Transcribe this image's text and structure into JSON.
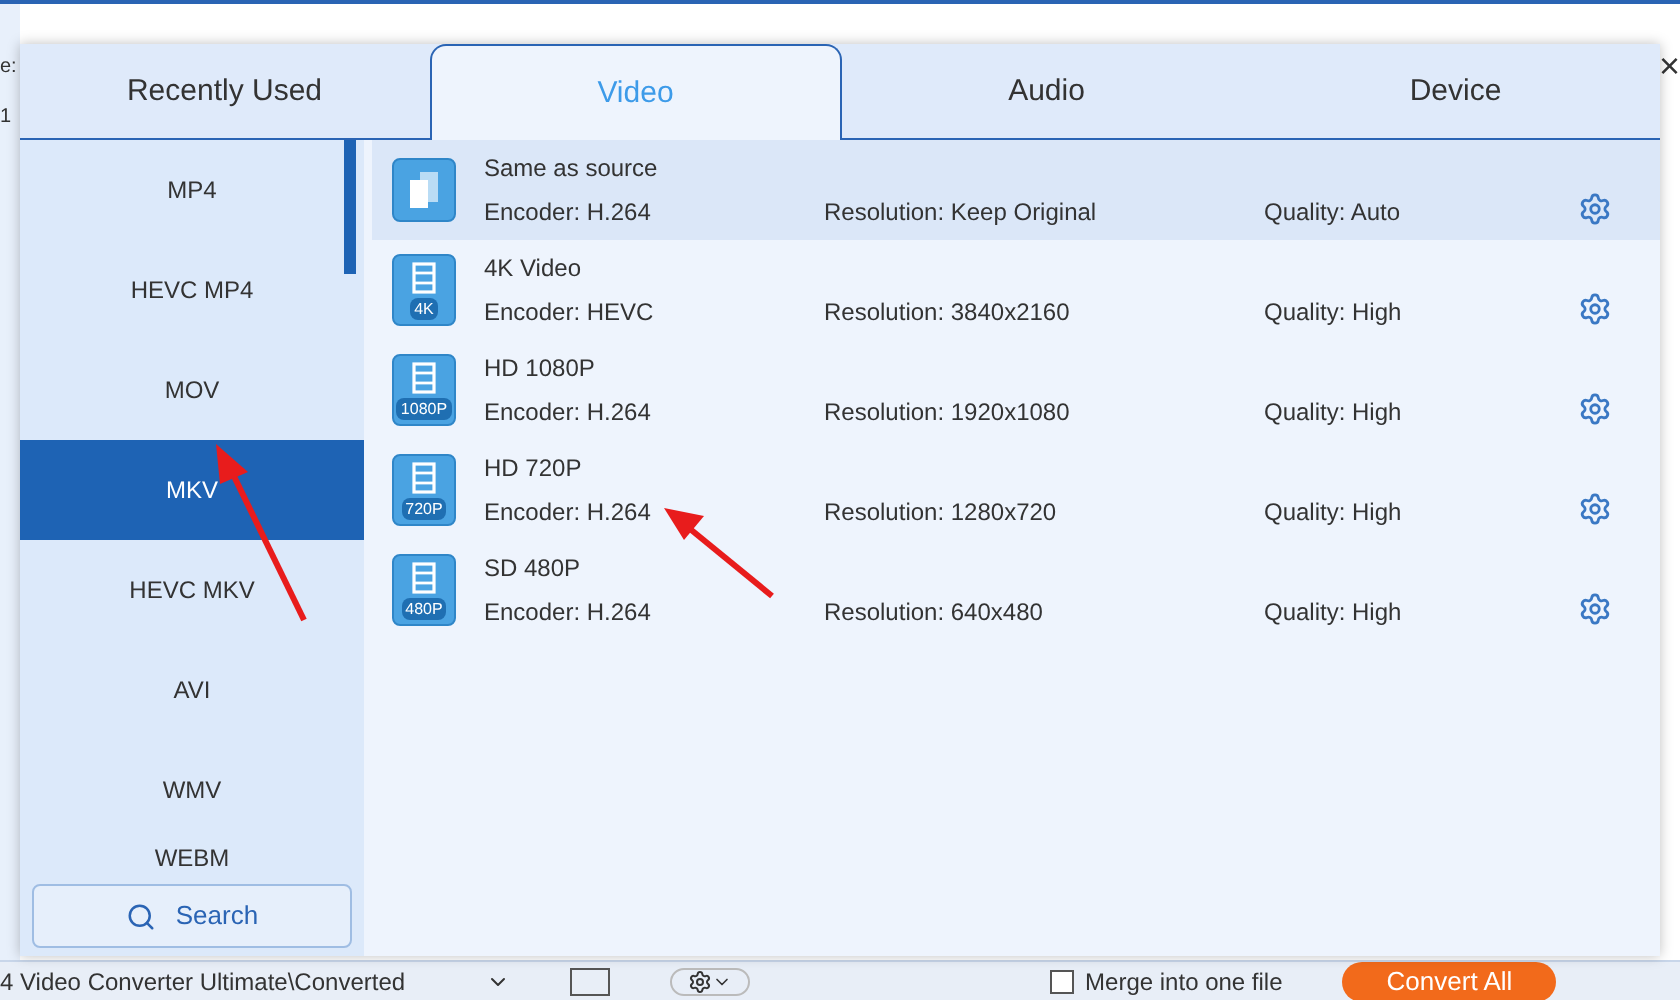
{
  "background": {
    "side_texts": [
      "e:",
      "1"
    ],
    "close_glyph": "×",
    "output_path": "4 Video Converter Ultimate\\Converted",
    "merge": {
      "label": "Merge into one file",
      "checked": false
    },
    "convert_button": "Convert All"
  },
  "tabs": [
    {
      "label": "Recently Used",
      "selected": false
    },
    {
      "label": "Video",
      "selected": true
    },
    {
      "label": "Audio",
      "selected": false
    },
    {
      "label": "Device",
      "selected": false
    }
  ],
  "formats": [
    {
      "label": "MP4",
      "selected": false
    },
    {
      "label": "HEVC MP4",
      "selected": false
    },
    {
      "label": "MOV",
      "selected": false
    },
    {
      "label": "MKV",
      "selected": true
    },
    {
      "label": "HEVC MKV",
      "selected": false
    },
    {
      "label": "AVI",
      "selected": false
    },
    {
      "label": "WMV",
      "selected": false
    },
    {
      "label": "WEBM",
      "selected": false
    }
  ],
  "search": {
    "label": "Search"
  },
  "presets": [
    {
      "kind": "source",
      "name": "Same as source",
      "encoder": "Encoder: H.264",
      "resolution": "Resolution: Keep Original",
      "quality": "Quality: Auto",
      "selected": true
    },
    {
      "kind": "video",
      "badge": "4K",
      "name": "4K Video",
      "encoder": "Encoder: HEVC",
      "resolution": "Resolution: 3840x2160",
      "quality": "Quality: High",
      "selected": false
    },
    {
      "kind": "video",
      "badge": "1080P",
      "name": "HD 1080P",
      "encoder": "Encoder: H.264",
      "resolution": "Resolution: 1920x1080",
      "quality": "Quality: High",
      "selected": false
    },
    {
      "kind": "video",
      "badge": "720P",
      "name": "HD 720P",
      "encoder": "Encoder: H.264",
      "resolution": "Resolution: 1280x720",
      "quality": "Quality: High",
      "selected": false
    },
    {
      "kind": "video",
      "badge": "480P",
      "name": "SD 480P",
      "encoder": "Encoder: H.264",
      "resolution": "Resolution: 640x480",
      "quality": "Quality: High",
      "selected": false
    }
  ]
}
